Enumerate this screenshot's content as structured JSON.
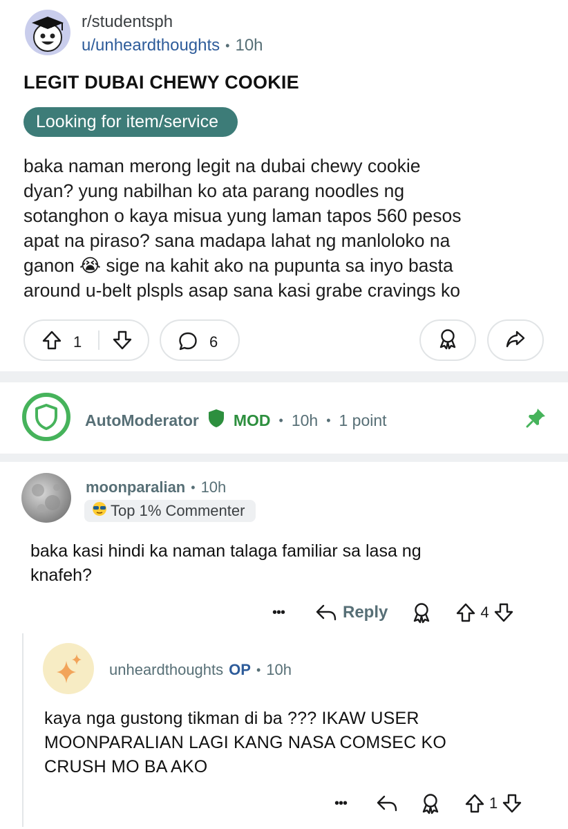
{
  "post": {
    "subreddit": "r/studentsph",
    "author": "u/unheardthoughts",
    "time": "10h",
    "title": "LEGIT DUBAI CHEWY COOKIE",
    "flair": "Looking for item/service",
    "body": "baka naman merong legit na dubai chewy cookie\ndyan? yung nabilhan ko ata parang noodles ng\nsotanghon o kaya misua yung laman tapos 560 pesos\napat na piraso? sana madapa lahat ng manloloko na\nganon 😭 sige na kahit ako na pupunta sa inyo basta\naround u-belt plspls asap sana kasi grabe cravings ko",
    "upvotes": "1",
    "comments": "6"
  },
  "automod": {
    "name": "AutoModerator",
    "badge": "MOD",
    "time": "10h",
    "points": "1 point"
  },
  "comment": {
    "author": "moonparalian",
    "time": "10h",
    "badge": "Top 1% Commenter",
    "body": "baka kasi hindi ka naman talaga familiar sa lasa ng\nknafeh?",
    "reply_label": "Reply",
    "votes": "4"
  },
  "reply": {
    "author": "unheardthoughts",
    "op_label": "OP",
    "time": "10h",
    "body": "kaya nga gustong tikman di ba ??? IKAW USER\nMOONPARALIAN LAGI KANG NASA COMSEC KO\nCRUSH MO BA AKO",
    "votes": "1"
  },
  "colors": {
    "flair_bg": "#3d7c78",
    "mod_green": "#2d8f3e",
    "link_blue": "#2e5c9a"
  }
}
